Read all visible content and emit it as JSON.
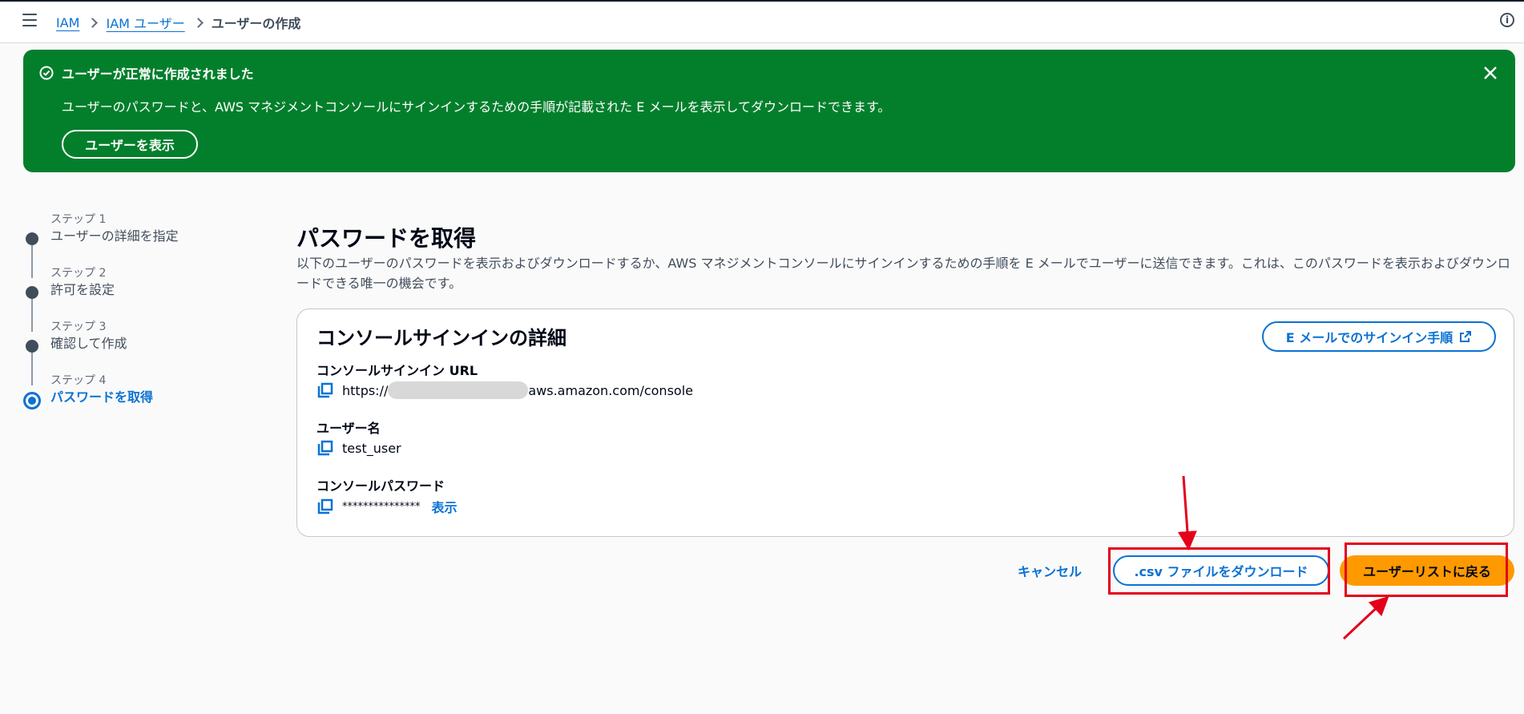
{
  "breadcrumb": {
    "items": [
      "IAM",
      "IAM ユーザー"
    ],
    "current": "ユーザーの作成"
  },
  "flash": {
    "title": "ユーザーが正常に作成されました",
    "message": "ユーザーのパスワードと、AWS マネジメントコンソールにサインインするための手順が記載された E メールを表示してダウンロードできます。",
    "button_label": "ユーザーを表示",
    "color": "#037f2c"
  },
  "steps": [
    {
      "num": "ステップ 1",
      "title": "ユーザーの詳細を指定"
    },
    {
      "num": "ステップ 2",
      "title": "許可を設定"
    },
    {
      "num": "ステップ 3",
      "title": "確認して作成"
    },
    {
      "num": "ステップ 4",
      "title": "パスワードを取得"
    }
  ],
  "main": {
    "title": "パスワードを取得",
    "description": "以下のユーザーのパスワードを表示およびダウンロードするか、AWS マネジメントコンソールにサインインするための手順を E メールでユーザーに送信できます。これは、このパスワードを表示およびダウンロードできる唯一の機会です。"
  },
  "card": {
    "title": "コンソールサインインの詳細",
    "email_button": "E メールでのサインイン手順",
    "url_label": "コンソールサインイン URL",
    "url_prefix": "https://",
    "url_suffix": "aws.amazon.com/console",
    "username_label": "ユーザー名",
    "username": "test_user",
    "password_label": "コンソールパスワード",
    "password": "***************",
    "show_label": "表示"
  },
  "actions": {
    "cancel": "キャンセル",
    "download_csv": ".csv ファイルをダウンロード",
    "back": "ユーザーリストに戻る"
  },
  "colors": {
    "link": "#0972d3",
    "primary": "#ff9900",
    "highlight": "#e3001b"
  }
}
